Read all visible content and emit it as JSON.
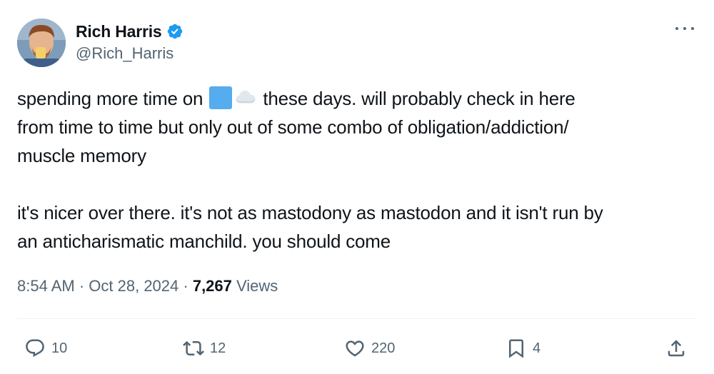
{
  "author": {
    "display_name": "Rich Harris",
    "handle": "@Rich_Harris",
    "verified": true
  },
  "tweet": {
    "text_line1_before": "spending more time on",
    "text_line1_after": "these days. will probably check in here",
    "text_line2": "from time to time but only out of some combo of obligation/addiction/",
    "text_line3": "muscle memory",
    "text_line4": "it's nicer over there. it's not as mastodony as mastodon and it isn't run by",
    "text_line5": "an anticharismatic manchild. you should come"
  },
  "meta": {
    "time": "8:54 AM",
    "sep1": " · ",
    "date": "Oct 28, 2024",
    "sep2": " · ",
    "views_count": "7,267",
    "views_label": " Views"
  },
  "actions": {
    "replies": "10",
    "reposts": "12",
    "likes": "220",
    "bookmarks": "4"
  },
  "icons": {
    "more": "more-horizontal-icon",
    "verified": "verified-badge-icon",
    "emoji1": "blue-square-emoji",
    "emoji2": "cloud-emoji",
    "reply": "reply-icon",
    "repost": "repost-icon",
    "like": "heart-icon",
    "bookmark": "bookmark-icon",
    "share": "share-icon"
  },
  "colors": {
    "text": "#0f1419",
    "secondary": "#536471",
    "verified": "#1d9bf0",
    "divider": "#eff3f4"
  }
}
